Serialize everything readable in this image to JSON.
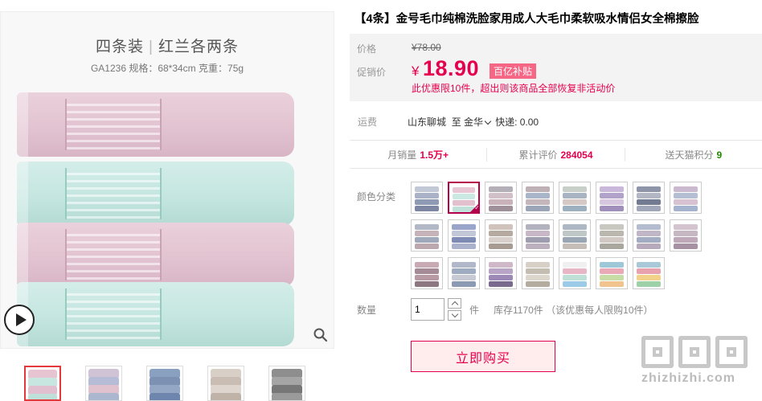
{
  "product": {
    "title": "【4条】金号毛巾纯棉洗脸家用成人大毛巾柔软吸水情侣女全棉擦脸",
    "image_caption_line1_a": "四条装",
    "image_caption_line1_b": "红兰各两条",
    "image_caption_line2": "GA1236   规格：68*34cm  克重：75g"
  },
  "price": {
    "label": "价格",
    "original": "¥78.00",
    "promo_label": "促销价",
    "currency": "¥",
    "promo_value": "18.90",
    "badge": "百亿补贴",
    "note": "此优惠限10件，超出则该商品全部恢复非活动价"
  },
  "shipping": {
    "label": "运费",
    "origin": "山东聊城",
    "to_label": "至",
    "destination": "金华",
    "method": "快递: 0.00"
  },
  "stats": {
    "monthly_sales_label": "月销量",
    "monthly_sales_value": "1.5万+",
    "reviews_label": "累计评价",
    "reviews_value": "284054",
    "points_label": "送天猫积分",
    "points_value": "9"
  },
  "color": {
    "label": "颜色分类",
    "selected_index": 1,
    "swatches": [
      [
        "#c3c8d6",
        "#aab2c8",
        "#8f9ab5",
        "#7d86a3"
      ],
      [
        "#e9c6d3",
        "#c9e9e2",
        "#e2c0ce",
        "#bfe1da"
      ],
      [
        "#b5b0b8",
        "#d2c0c8",
        "#c9b2ba",
        "#9e8f99"
      ],
      [
        "#bfb0b5",
        "#a9b6c9",
        "#c4b6bb",
        "#9aa5b7"
      ],
      [
        "#c8cfc8",
        "#a8b4c2",
        "#d5c8c5",
        "#9db0bf"
      ],
      [
        "#c9b8d9",
        "#b0a2c8",
        "#d6c7de",
        "#9f8fba"
      ],
      [
        "#8f95a9",
        "#b3b7c4",
        "#737b93",
        "#a1a7b8"
      ],
      [
        "#cbb9cf",
        "#b5bfd4",
        "#d7c2d2",
        "#a6b3cf"
      ],
      [
        "#b3b8c6",
        "#c5b3b9",
        "#a0a8bc",
        "#bca9b0"
      ],
      [
        "#9aa6c9",
        "#c2c7d8",
        "#7e8bb5",
        "#aab2cc"
      ],
      [
        "#cfc3bc",
        "#b6a99f",
        "#d9cfca",
        "#a89c92"
      ],
      [
        "#b3b3c0",
        "#c7b7c7",
        "#9e9eb0",
        "#bcb0bf"
      ],
      [
        "#aeb7c4",
        "#bfc8c6",
        "#9ba6b4",
        "#c4bdb8"
      ],
      [
        "#c8c7c0",
        "#b9b7ae",
        "#d1c8c3",
        "#aaa79f"
      ],
      [
        "#b4bdd0",
        "#c1b6c7",
        "#a2adc4",
        "#b7aabd"
      ],
      [
        "#d3c4cf",
        "#c6b7c3",
        "#bfa9b8",
        "#a692a3"
      ],
      [
        "#c7aab4",
        "#a58b95",
        "#b89aa4",
        "#8d7882"
      ],
      [
        "#b0b8c9",
        "#9eabc1",
        "#c7cad5",
        "#8c9ab3"
      ],
      [
        "#cfb9c8",
        "#b8a4c4",
        "#9d89b5",
        "#7a6a8e"
      ],
      [
        "#d6d0c6",
        "#c4bdb1",
        "#ddd6cc",
        "#b4ad9f"
      ],
      [
        "#f0f0f0",
        "#e8b7c6",
        "#bfe0d6",
        "#9ccbe8"
      ],
      [
        "#9ec7d8",
        "#e9a9b6",
        "#c8dca8",
        "#f1c38f"
      ],
      [
        "#a9c8d8",
        "#e7a2ad",
        "#f2d28a",
        "#9fd1a9"
      ]
    ]
  },
  "quantity": {
    "label": "数量",
    "value": "1",
    "unit": "件",
    "stock": "库存1170件  （该优惠每人限购10件）"
  },
  "buy_button": "立即购买",
  "watermark": "zhizhizhi.com",
  "thumbnails": [
    {
      "active": true,
      "colors": [
        "#e7c4d2",
        "#c6e6df",
        "#e2bfcf",
        "#bfe0d8"
      ]
    },
    {
      "active": false,
      "colors": [
        "#cfc3d5",
        "#b7bcd6",
        "#e0c2cf",
        "#aab7cf"
      ]
    },
    {
      "active": false,
      "colors": [
        "#8aa0c0",
        "#7d92b3",
        "#94a8c6",
        "#6e86ad"
      ]
    },
    {
      "active": false,
      "colors": [
        "#d8cfc7",
        "#c9bdb3",
        "#ded5ce",
        "#bfb3a8"
      ]
    },
    {
      "active": false,
      "colors": [
        "#8e8e8e",
        "#a5a5a5",
        "#777777",
        "#9a9a9a"
      ]
    }
  ]
}
